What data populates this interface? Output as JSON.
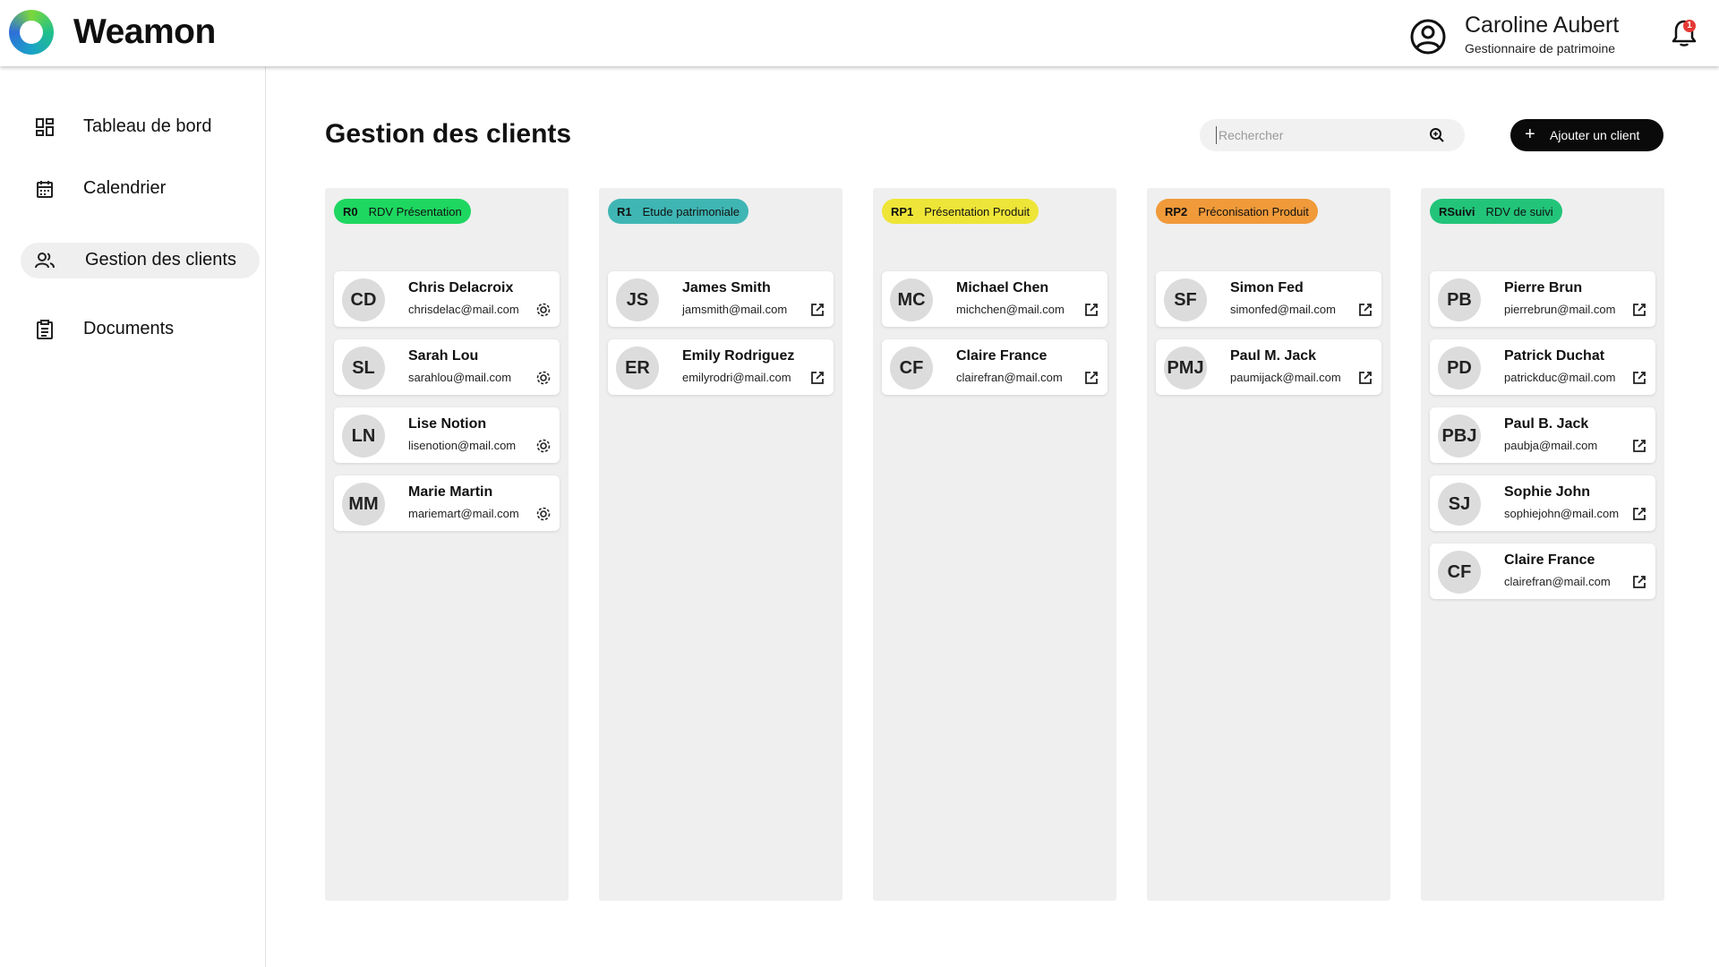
{
  "header": {
    "brand": "Weamon",
    "user_name": "Caroline Aubert",
    "user_role": "Gestionnaire de patrimoine",
    "notification_count": "1"
  },
  "sidebar": {
    "items": [
      {
        "label": "Tableau de bord",
        "icon": "dashboard-icon",
        "active": false
      },
      {
        "label": "Calendrier",
        "icon": "calendar-icon",
        "active": false
      },
      {
        "label": "Gestion des clients",
        "icon": "users-icon",
        "active": true
      },
      {
        "label": "Documents",
        "icon": "document-icon",
        "active": false
      }
    ]
  },
  "main": {
    "title": "Gestion des clients",
    "search_placeholder": "Rechercher",
    "add_button_label": "Ajouter un client",
    "columns": [
      {
        "code": "R0",
        "label": "RDV Présentation",
        "color": "#1ed760",
        "cards": [
          {
            "initials": "CD",
            "name": "Chris Delacroix",
            "email": "chrisdelac@mail.com",
            "action_icon": "gear-icon"
          },
          {
            "initials": "SL",
            "name": "Sarah Lou",
            "email": "sarahlou@mail.com",
            "action_icon": "gear-icon"
          },
          {
            "initials": "LN",
            "name": "Lise Notion",
            "email": "lisenotion@mail.com",
            "action_icon": "gear-icon"
          },
          {
            "initials": "MM",
            "name": "Marie Martin",
            "email": "mariemart@mail.com",
            "action_icon": "gear-icon"
          }
        ]
      },
      {
        "code": "R1",
        "label": "Etude patrimoniale",
        "color": "#3fb6b4",
        "cards": [
          {
            "initials": "JS",
            "name": "James Smith",
            "email": "jamsmith@mail.com",
            "action_icon": "external-link-icon"
          },
          {
            "initials": "ER",
            "name": "Emily Rodriguez",
            "email": "emilyrodri@mail.com",
            "action_icon": "external-link-icon"
          }
        ]
      },
      {
        "code": "RP1",
        "label": "Présentation Produit",
        "color": "#eee538",
        "cards": [
          {
            "initials": "MC",
            "name": "Michael Chen",
            "email": "michchen@mail.com",
            "action_icon": "external-link-icon"
          },
          {
            "initials": "CF",
            "name": "Claire France",
            "email": "clairefran@mail.com",
            "action_icon": "external-link-icon"
          }
        ]
      },
      {
        "code": "RP2",
        "label": "Préconisation Produit",
        "color": "#f09a3a",
        "cards": [
          {
            "initials": "SF",
            "name": "Simon Fed",
            "email": "simonfed@mail.com",
            "action_icon": "external-link-icon"
          },
          {
            "initials": "PMJ",
            "name": "Paul M. Jack",
            "email": "paumijack@mail.com",
            "action_icon": "external-link-icon"
          }
        ]
      },
      {
        "code": "RSuivi",
        "label": "RDV de suivi",
        "color": "#22c47a",
        "cards": [
          {
            "initials": "PB",
            "name": "Pierre Brun",
            "email": "pierrebrun@mail.com",
            "action_icon": "external-link-icon"
          },
          {
            "initials": "PD",
            "name": "Patrick Duchat",
            "email": "patrickduc@mail.com",
            "action_icon": "external-link-icon"
          },
          {
            "initials": "PBJ",
            "name": "Paul B. Jack",
            "email": "paubja@mail.com",
            "action_icon": "external-link-icon"
          },
          {
            "initials": "SJ",
            "name": "Sophie John",
            "email": "sophiejohn@mail.com",
            "action_icon": "external-link-icon"
          },
          {
            "initials": "CF",
            "name": "Claire France",
            "email": "clairefran@mail.com",
            "action_icon": "external-link-icon"
          }
        ]
      }
    ]
  }
}
